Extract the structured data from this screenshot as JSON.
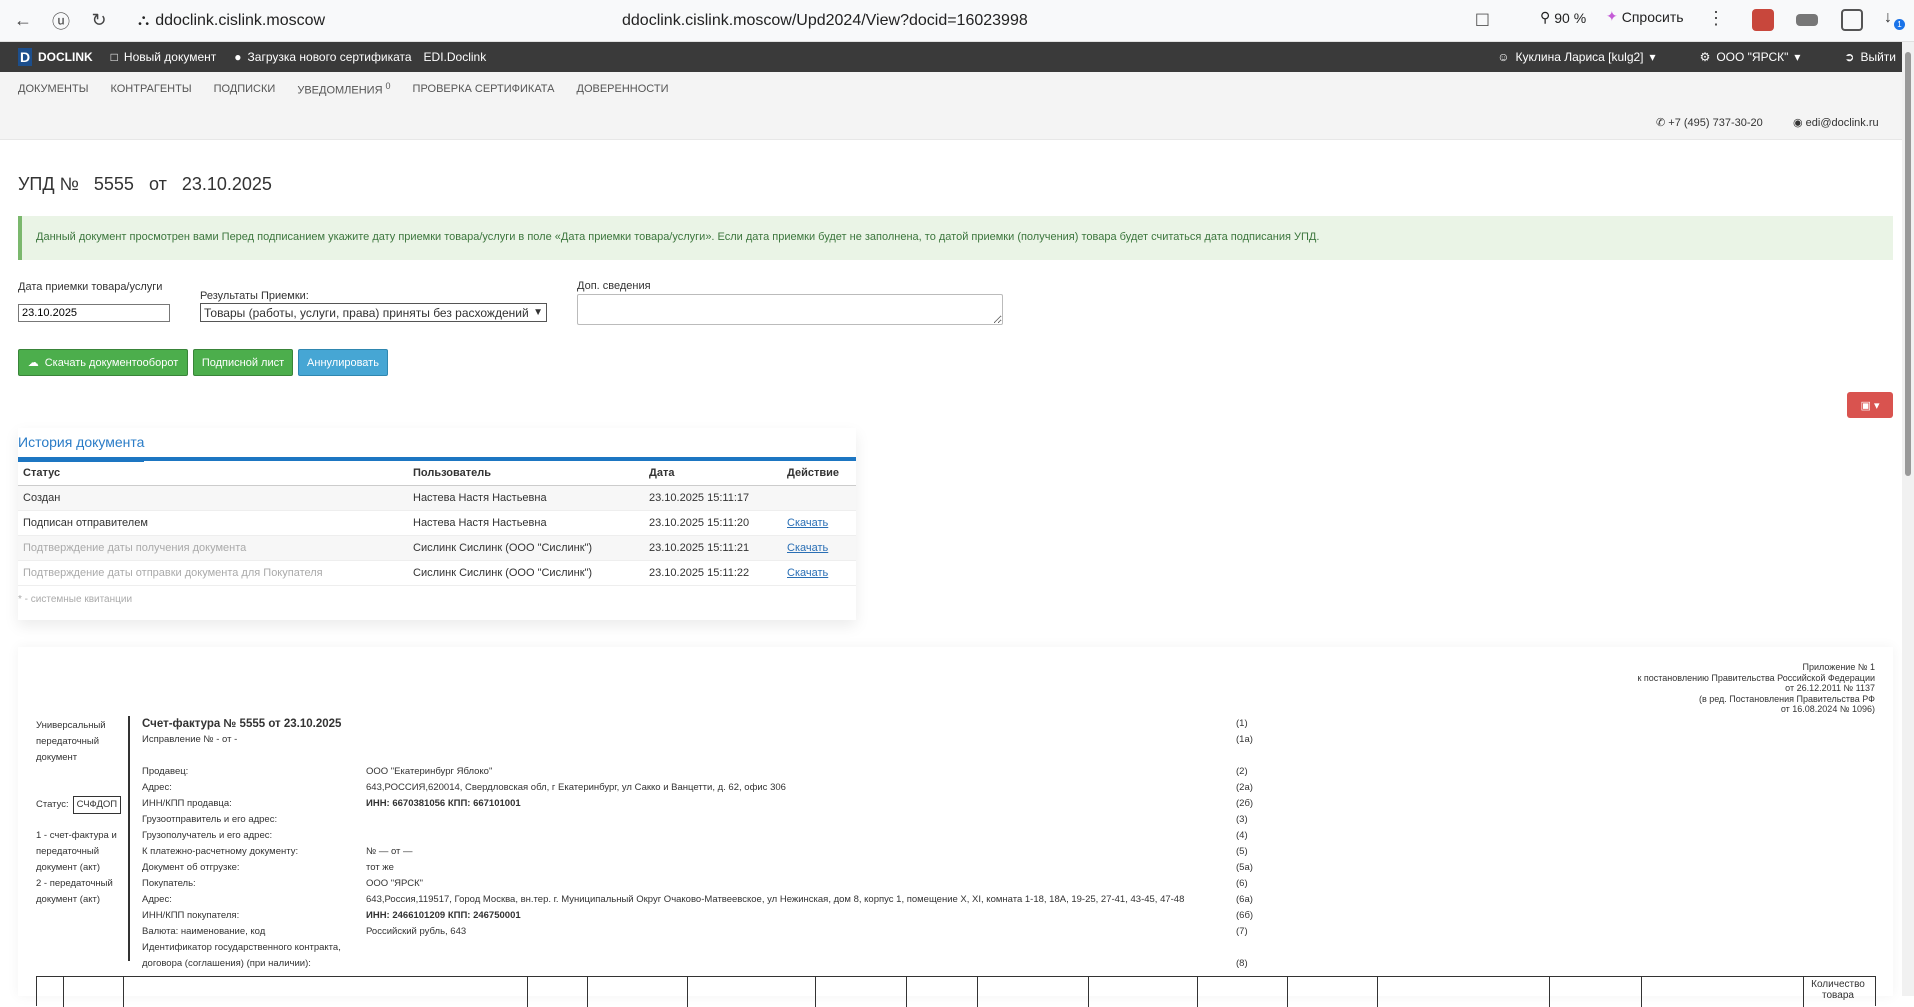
{
  "browser": {
    "domain": "ddoclink.cislink.moscow",
    "url": "ddoclink.cislink.moscow/Upd2024/View?docid=16023998",
    "zoom": "90 %",
    "ask": "Спросить",
    "badge": "1"
  },
  "topbar": {
    "logo": "DOCLINK",
    "logo_letter": "D",
    "new_doc": "Новый документ",
    "upload_cert": "Загрузка нового сертификата",
    "edi": "EDI.Doclink",
    "user": "Куклина Лариса [kulg2]",
    "org": "ООО \"ЯРСК\"",
    "logout": "Выйти"
  },
  "subnav": {
    "items": [
      "ДОКУМЕНТЫ",
      "КОНТРАГЕНТЫ",
      "ПОДПИСКИ",
      "УВЕДОМЛЕНИЯ",
      "ПРОВЕРКА СЕРТИФИКАТА",
      "ДОВЕРЕННОСТИ"
    ],
    "notif_count": "0"
  },
  "contacts": {
    "phone": "+7 (495) 737-30-20",
    "email": "edi@doclink.ru"
  },
  "page": {
    "title_prefix": "УПД №",
    "number": "5555",
    "from": "от",
    "date": "23.10.2025",
    "alert": "Данный документ просмотрен вами  Перед подписанием укажите дату приемки товара/услуги в поле «Дата приемки товара/услуги». Если дата приемки будет не заполнена, то датой приемки (получения) товара будет считаться дата подписания УПД."
  },
  "form": {
    "date_label": "Дата приемки товара/услуги",
    "date_value": "23.10.2025",
    "result_label": "Результаты Приемки:",
    "result_value": "Товары (работы, услуги, права) приняты без расхождений",
    "extra_label": "Доп. сведения"
  },
  "buttons": {
    "download": "Скачать документооборот",
    "sign_sheet": "Подписной лист",
    "annul": "Аннулировать"
  },
  "history": {
    "tab": "История документа",
    "headers": [
      "Статус",
      "Пользователь",
      "Дата",
      "Действие"
    ],
    "rows": [
      {
        "status": "Создан",
        "user": "Настева Настя Настьевна",
        "date": "23.10.2025 15:11:17",
        "action": ""
      },
      {
        "status": "Подписан отправителем",
        "user": "Настева Настя Настьевна",
        "date": "23.10.2025 15:11:20",
        "action": "Скачать"
      },
      {
        "status": "Подтверждение даты получения документа",
        "user": "Сислинк Сислинк (ООО \"Сислинк\")",
        "date": "23.10.2025 15:11:21",
        "action": "Скачать"
      },
      {
        "status": "Подтверждение даты отправки документа для Покупателя",
        "user": "Сислинк Сислинк (ООО \"Сислинк\")",
        "date": "23.10.2025 15:11:22",
        "action": "Скачать"
      }
    ],
    "note": "* - системные квитанции"
  },
  "doc": {
    "appendix": [
      "Приложение № 1",
      "к постановлению Правительства Российской Федерации",
      "от 26.12.2011 № 1137",
      "(в ред. Постановления Правительства РФ",
      "от 16.08.2024 № 1096)"
    ],
    "left_title": "Универсальный передаточный документ",
    "status_label": "Статус:",
    "status_value": "СЧФДОП",
    "left_note1": "1 - счет-фактура и передаточный документ (акт)",
    "left_note2": "2 - передаточный документ (акт)",
    "invoice_title": "Счет-фактура № 5555  от 23.10.2025",
    "rows": [
      {
        "k": "Исправление № - от -",
        "v": "",
        "n": "(1а)"
      },
      {
        "k": "",
        "v": "",
        "n": ""
      },
      {
        "k": "Продавец:",
        "v": "ООО \"Екатеринбург Яблоко\"",
        "n": "(2)"
      },
      {
        "k": "Адрес:",
        "v": "643,РОССИЯ,620014, Свердловская обл, г Екатеринбург, ул Сакко и Ванцетти, д. 62, офис 306",
        "n": "(2а)"
      },
      {
        "k": "ИНН/КПП продавца:",
        "v": "ИНН: 6670381056 КПП: 667101001",
        "n": "(2б)"
      },
      {
        "k": "Грузоотправитель и его адрес:",
        "v": "",
        "n": "(3)"
      },
      {
        "k": "Грузополучатель и его адрес:",
        "v": "",
        "n": "(4)"
      },
      {
        "k": "К платежно-расчетному документу:",
        "v": "№  — от —",
        "n": "(5)"
      },
      {
        "k": "Документ об отгрузке:",
        "v": "тот же",
        "n": "(5а)"
      },
      {
        "k": "Покупатель:",
        "v": "ООО \"ЯРСК\"",
        "n": "(6)"
      },
      {
        "k": "Адрес:",
        "v": "643,Россия,119517, Город Москва, вн.тер. г. Муниципальный Округ Очаково-Матвеевское, ул Нежинская, дом 8, корпус 1, помещение X, XI, комната 1-18, 18А, 19-25, 27-41, 43-45, 47-48",
        "n": "(6а)"
      },
      {
        "k": "ИНН/КПП покупателя:",
        "v": "ИНН: 2466101209 КПП: 246750001",
        "n": "(6б)"
      },
      {
        "k": "Валюта: наименование, код",
        "v": "Российский рубль,  643",
        "n": "(7)"
      },
      {
        "k": "Идентификатор государственного контракта,",
        "v": "",
        "n": ""
      },
      {
        "k": "договора (соглашения) (при наличии):",
        "v": "",
        "n": "(8)"
      }
    ],
    "first_num": "(1)",
    "qty": "Количество товара"
  }
}
